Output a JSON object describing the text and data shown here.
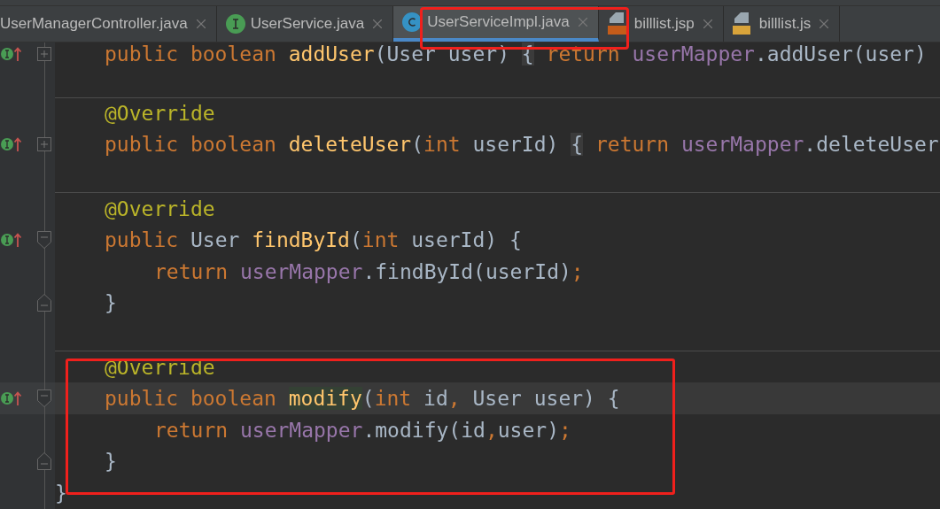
{
  "tabs": [
    {
      "label": "UserManagerController.java",
      "kind": "plain",
      "selected": false
    },
    {
      "label": "UserService.java",
      "kind": "interface",
      "selected": false
    },
    {
      "label": "UserServiceImpl.java",
      "kind": "class",
      "selected": true
    },
    {
      "label": "billlist.jsp",
      "kind": "jsp",
      "selected": false
    },
    {
      "label": "billlist.js",
      "kind": "js",
      "selected": false
    }
  ],
  "editor": {
    "body": [
      {
        "kind": "code",
        "separator_above": false,
        "override_marker": true,
        "folded": true,
        "fold_open": false,
        "fold_close": false,
        "current": false,
        "tokens": [
          {
            "kind": "keyword",
            "text": "public boolean "
          },
          {
            "kind": "method",
            "text": "addUser"
          },
          {
            "kind": "plain",
            "text": "(User user) "
          },
          {
            "kind": "folded",
            "text": "{"
          },
          {
            "kind": "keyword",
            "text": " return "
          },
          {
            "kind": "field",
            "text": "userMapper"
          },
          {
            "kind": "plain",
            "text": ".addUser(user)"
          }
        ]
      },
      {
        "kind": "blank",
        "separator_above": false,
        "override_marker": false,
        "folded": false,
        "fold_open": false,
        "fold_close": false,
        "current": false
      },
      {
        "kind": "code",
        "separator_above": true,
        "override_marker": false,
        "folded": false,
        "fold_open": false,
        "fold_close": false,
        "current": false,
        "tokens": [
          {
            "kind": "annotation",
            "text": "@Override"
          }
        ]
      },
      {
        "kind": "code",
        "separator_above": false,
        "override_marker": true,
        "folded": true,
        "fold_open": false,
        "fold_close": false,
        "current": false,
        "tokens": [
          {
            "kind": "keyword",
            "text": "public boolean "
          },
          {
            "kind": "method",
            "text": "deleteUser"
          },
          {
            "kind": "plain",
            "text": "("
          },
          {
            "kind": "keyword",
            "text": "int "
          },
          {
            "kind": "plain",
            "text": "userId) "
          },
          {
            "kind": "folded",
            "text": "{"
          },
          {
            "kind": "keyword",
            "text": " return "
          },
          {
            "kind": "field",
            "text": "userMapper"
          },
          {
            "kind": "plain",
            "text": ".deleteUser"
          }
        ]
      },
      {
        "kind": "blank",
        "separator_above": false,
        "override_marker": false,
        "folded": false,
        "fold_open": false,
        "fold_close": false,
        "current": false
      },
      {
        "kind": "code",
        "separator_above": true,
        "override_marker": false,
        "folded": false,
        "fold_open": false,
        "fold_close": false,
        "current": false,
        "tokens": [
          {
            "kind": "annotation",
            "text": "@Override"
          }
        ]
      },
      {
        "kind": "code",
        "separator_above": false,
        "override_marker": true,
        "folded": false,
        "fold_open": true,
        "fold_close": false,
        "current": false,
        "tokens": [
          {
            "kind": "keyword",
            "text": "public "
          },
          {
            "kind": "plain",
            "text": "User "
          },
          {
            "kind": "method",
            "text": "findById"
          },
          {
            "kind": "plain",
            "text": "("
          },
          {
            "kind": "keyword",
            "text": "int "
          },
          {
            "kind": "plain",
            "text": "userId) {"
          }
        ],
        "children": [
          {
            "tokens": [
              {
                "kind": "keyword",
                "text": "return "
              },
              {
                "kind": "field",
                "text": "userMapper"
              },
              {
                "kind": "plain",
                "text": ".findById(userId)"
              },
              {
                "kind": "keyword",
                "text": ";"
              }
            ]
          }
        ]
      },
      {
        "kind": "code",
        "separator_above": false,
        "override_marker": false,
        "folded": false,
        "fold_open": false,
        "fold_close": true,
        "current": false,
        "tokens": [
          {
            "kind": "plain",
            "text": "}"
          }
        ]
      },
      {
        "kind": "blank",
        "separator_above": false,
        "override_marker": false,
        "folded": false,
        "fold_open": false,
        "fold_close": false,
        "current": false
      },
      {
        "kind": "code",
        "separator_above": true,
        "override_marker": false,
        "folded": false,
        "fold_open": false,
        "fold_close": false,
        "current": false,
        "tokens": [
          {
            "kind": "annotation",
            "text": "@Override"
          }
        ]
      },
      {
        "kind": "code",
        "separator_above": false,
        "override_marker": true,
        "folded": false,
        "fold_open": true,
        "fold_close": false,
        "current": true,
        "tokens": [
          {
            "kind": "keyword",
            "text": "public boolean "
          },
          {
            "kind": "method-match",
            "text": "modify"
          },
          {
            "kind": "plain",
            "text": "("
          },
          {
            "kind": "keyword",
            "text": "int "
          },
          {
            "kind": "plain",
            "text": "id"
          },
          {
            "kind": "keyword",
            "text": ", "
          },
          {
            "kind": "plain",
            "text": "User user) {"
          }
        ],
        "children": [
          {
            "tokens": [
              {
                "kind": "keyword",
                "text": "return "
              },
              {
                "kind": "field",
                "text": "userMapper"
              },
              {
                "kind": "plain",
                "text": ".modify(id"
              },
              {
                "kind": "keyword",
                "text": ","
              },
              {
                "kind": "plain",
                "text": "user)"
              },
              {
                "kind": "keyword",
                "text": ";"
              }
            ]
          }
        ]
      },
      {
        "kind": "code",
        "separator_above": false,
        "override_marker": false,
        "folded": false,
        "fold_open": false,
        "fold_close": true,
        "current": false,
        "tokens": [
          {
            "kind": "plain",
            "text": "}"
          }
        ]
      }
    ],
    "closing": {
      "tokens": [
        {
          "kind": "plain",
          "text": "}"
        }
      ]
    }
  }
}
